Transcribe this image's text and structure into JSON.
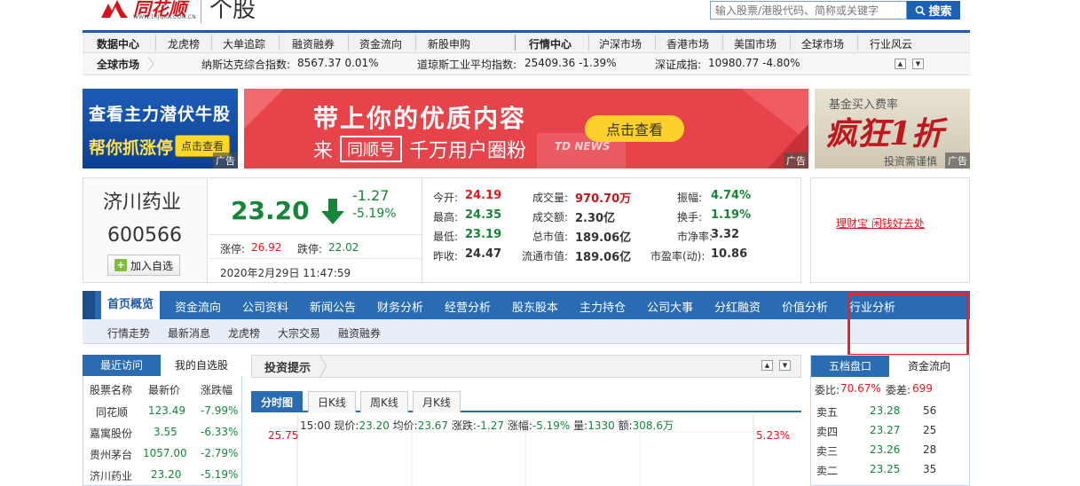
{
  "header": {
    "brand": "同花顺",
    "brand_url": "WWW.10JQKA.COM.CN",
    "section_title": "个股",
    "search_placeholder": "输入股票/港股代码、简称或关键字",
    "search_button": "搜索"
  },
  "nav_primary": {
    "data_center": "数据中心",
    "items_left": [
      "龙虎榜",
      "大单追踪",
      "融资融券",
      "资金流向",
      "新股申购"
    ],
    "market_center": "行情中心",
    "items_right": [
      "沪深市场",
      "香港市场",
      "美国市场",
      "全球市场",
      "行业风云"
    ]
  },
  "nav_global": {
    "label": "全球市场",
    "indices": [
      {
        "name": "纳斯达克综合指数:",
        "value": "8567.37 0.01%"
      },
      {
        "name": "道琼斯工业平均指数:",
        "value": "25409.36 -1.39%"
      },
      {
        "name": "深证成指:",
        "value": "10980.77 -4.80%"
      }
    ]
  },
  "ads": {
    "ad1_line1": "查看主力潜伏牛股",
    "ad1_line2": "帮你抓涨停",
    "ad1_button": "点击查看",
    "ad2_line1": "带上你的优质内容",
    "ad2_line2_pre": "来",
    "ad2_chip": "同顺号",
    "ad2_line2_post": "千万用户圈粉",
    "ad2_button": "点击查看",
    "ad2_brand": "TD NEWS",
    "ad3_line1": "基金买入费率",
    "ad3_line2": "疯狂1折",
    "ad3_line3": "投资需谨慎",
    "ad_tag": "广告"
  },
  "stock": {
    "name": "济川药业",
    "code": "600566",
    "add_watch": "加入自选",
    "price": "23.20",
    "change": "-1.27",
    "change_pct": "-5.19%",
    "limit_up_label": "涨停:",
    "limit_up": "26.92",
    "limit_down_label": "跌停:",
    "limit_down": "22.02",
    "time": "2020年2月29日 11:47:59",
    "quotes": [
      {
        "label": "今开:",
        "value": "24.19",
        "tone": "red"
      },
      {
        "label": "成交量:",
        "value": "970.70万",
        "tone": "dark-red"
      },
      {
        "label": "振幅:",
        "value": "4.74%",
        "tone": "green"
      },
      {
        "label": "最高:",
        "value": "24.35",
        "tone": "green"
      },
      {
        "label": "成交额:",
        "value": "2.30亿",
        "tone": "plain"
      },
      {
        "label": "换手:",
        "value": "1.19%",
        "tone": "green"
      },
      {
        "label": "最低:",
        "value": "23.19",
        "tone": "green"
      },
      {
        "label": "总市值:",
        "value": "189.06亿",
        "tone": "plain"
      },
      {
        "label": "市净率:",
        "value": "3.32",
        "tone": "plain"
      },
      {
        "label": "昨收:",
        "value": "24.47",
        "tone": "plain"
      },
      {
        "label": "流通市值:",
        "value": "189.06亿",
        "tone": "plain"
      },
      {
        "label": "市盈率(动):",
        "value": "10.86",
        "tone": "plain"
      }
    ],
    "finance_link": "理财宝 闲钱好去处"
  },
  "main_tabs": [
    "首页概览",
    "资金流向",
    "公司资料",
    "新闻公告",
    "财务分析",
    "经营分析",
    "股东股本",
    "主力持仓",
    "公司大事",
    "分红融资",
    "价值分析",
    "行业分析"
  ],
  "sub_tabs": [
    "行情走势",
    "最新消息",
    "龙虎榜",
    "大宗交易",
    "融资融券"
  ],
  "watchlist": {
    "tab_recent": "最近访问",
    "tab_mine": "我的自选股",
    "headers": [
      "股票名称",
      "最新价",
      "涨跌幅"
    ],
    "rows": [
      {
        "name": "同花顺",
        "price": "123.49",
        "change": "-7.99%"
      },
      {
        "name": "嘉寓股份",
        "price": "3.55",
        "change": "-6.33%"
      },
      {
        "name": "贵州茅台",
        "price": "1057.00",
        "change": "-2.79%"
      },
      {
        "name": "济川药业",
        "price": "23.20",
        "change": "-5.19%"
      }
    ]
  },
  "invest": {
    "title": "投资提示",
    "chart_tabs": [
      "分时图",
      "日K线",
      "周K线",
      "月K线"
    ],
    "quote_time": "15:00",
    "quote_now_label": "现价:",
    "quote_now": "23.20",
    "quote_avg_label": "均价:",
    "quote_avg": "23.67",
    "quote_chg_label": "涨跌:",
    "quote_chg": "-1.27",
    "quote_pct_label": "涨幅:",
    "quote_pct": "-5.19%",
    "quote_vol_label": "量:",
    "quote_vol": "1330",
    "quote_amt_label": "额:",
    "quote_amt": "308.6万",
    "y_top": "25.75",
    "pct_top": "5.23%"
  },
  "orderbook": {
    "tab_five": "五档盘口",
    "tab_flow": "资金流向",
    "ratio_label": "委比:",
    "ratio": "70.67%",
    "diff_label": "委差:",
    "diff": "699",
    "rows": [
      {
        "label": "卖五",
        "price": "23.28",
        "vol": "56"
      },
      {
        "label": "卖四",
        "price": "23.27",
        "vol": "25"
      },
      {
        "label": "卖三",
        "price": "23.26",
        "vol": "28"
      },
      {
        "label": "卖二",
        "price": "23.25",
        "vol": "35"
      }
    ]
  },
  "colors": {
    "brand_blue": "#1f5aa6",
    "up_red": "#e8141a",
    "down_green": "#15853a"
  }
}
